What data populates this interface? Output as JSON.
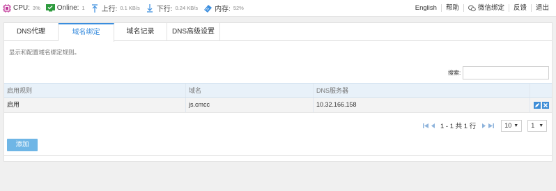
{
  "status": {
    "cpu_label": "CPU:",
    "cpu_value": "3%",
    "online_label": "Online:",
    "online_value": "1",
    "up_label": "上行:",
    "up_value": "0.1 KB/s",
    "down_label": "下行:",
    "down_value": "0.24 KB/s",
    "mem_label": "内存:",
    "mem_value": "52%",
    "colors": {
      "cpu": "#c0399a",
      "online": "#2e9b3e",
      "up": "#3a8dde",
      "down": "#3a8dde",
      "mem": "#3a8dde"
    }
  },
  "header_links": {
    "english": "English",
    "help": "帮助",
    "wechat": "微信绑定",
    "feedback": "反馈",
    "logout": "退出"
  },
  "tabs": [
    {
      "label": "DNS代理",
      "active": false
    },
    {
      "label": "域名绑定",
      "active": true
    },
    {
      "label": "域名记录",
      "active": false
    },
    {
      "label": "DNS高级设置",
      "active": false
    }
  ],
  "description": "显示和配置域名绑定规则。",
  "search": {
    "label": "搜索:",
    "value": "",
    "placeholder": ""
  },
  "table": {
    "columns": [
      "启用规则",
      "域名",
      "DNS服务器",
      ""
    ],
    "rows": [
      {
        "enabled": "启用",
        "domain": "js.cmcc",
        "dns_server": "10.32.166.158",
        "actions": [
          "edit-icon",
          "delete-icon"
        ]
      }
    ]
  },
  "pagination": {
    "info": "1 - 1 共 1 行",
    "page_size": "10",
    "page": "1"
  },
  "add_button": "添加",
  "accent_color": "#3a8dde"
}
